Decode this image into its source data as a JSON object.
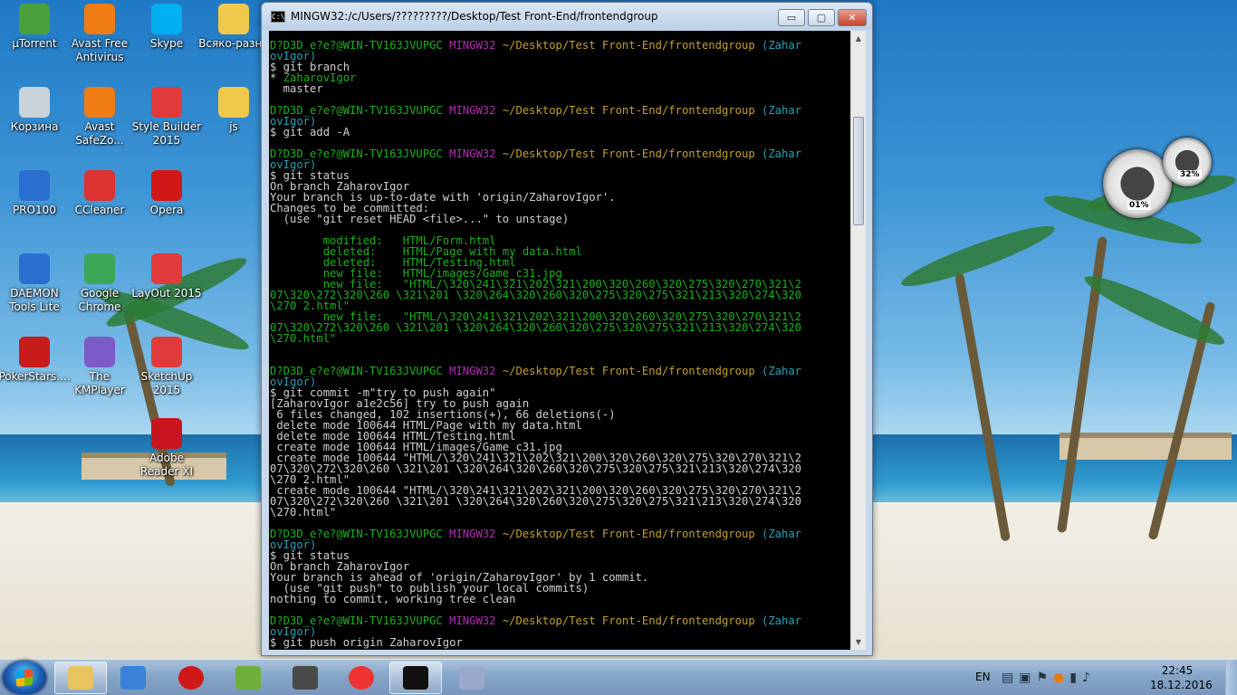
{
  "desktop_icons": [
    {
      "label": "µTorrent",
      "icon": "utorrent-icon",
      "color": "#4aa13b"
    },
    {
      "label": "Avast Free\nAntivirus",
      "icon": "avast-icon",
      "color": "#f07c14"
    },
    {
      "label": "Skype",
      "icon": "skype-icon",
      "color": "#00aff0"
    },
    {
      "label": "Всяко-разно",
      "icon": "folder-icon",
      "color": "#f0c84c"
    },
    {
      "label": "Корзина",
      "icon": "recycle-bin-icon",
      "color": "#c9d3dc"
    },
    {
      "label": "Avast\nSafeZo...",
      "icon": "avast-safezone-icon",
      "color": "#f07c14"
    },
    {
      "label": "Style Builder\n2015",
      "icon": "style-builder-icon",
      "color": "#e03a3a"
    },
    {
      "label": "js",
      "icon": "folder-icon",
      "color": "#f0c84c"
    },
    {
      "label": "PRO100",
      "icon": "pro100-icon",
      "color": "#2a6fd0"
    },
    {
      "label": "CCleaner",
      "icon": "ccleaner-icon",
      "color": "#d33"
    },
    {
      "label": "Opera",
      "icon": "opera-icon",
      "color": "#d01818"
    },
    {
      "label": "DAEMON\nTools Lite",
      "icon": "daemon-tools-icon",
      "color": "#2a6fd0"
    },
    {
      "label": "Google\nChrome",
      "icon": "chrome-icon",
      "color": "#3aa757"
    },
    {
      "label": "LayOut 2015",
      "icon": "layout-icon",
      "color": "#e03a3a"
    },
    {
      "label": "PokerStars....",
      "icon": "pokerstars-icon",
      "color": "#c81c1c"
    },
    {
      "label": "The\nKMPlayer",
      "icon": "kmplayer-icon",
      "color": "#7b5cc7"
    },
    {
      "label": "SketchUp\n2015",
      "icon": "sketchup-icon",
      "color": "#e03a3a"
    },
    {
      "label": "Adobe\nReader XI",
      "icon": "adobe-reader-icon",
      "color": "#c8141e"
    }
  ],
  "window": {
    "title": "MINGW32:/c/Users/?????????/Desktop/Test Front-End/frontendgroup",
    "minimize": "▭",
    "maximize": "▢",
    "close": "✕"
  },
  "terminal_lines": [
    [
      {
        "t": "D?D3D_e?e?@WIN-TV163JVUPGC ",
        "c": "g"
      },
      {
        "t": "MINGW32 ",
        "c": "p"
      },
      {
        "t": "~/Desktop/Test Front-End/frontendgroup ",
        "c": "y"
      },
      {
        "t": "(Zahar",
        "c": "c"
      }
    ],
    [
      {
        "t": "ovIgor)",
        "c": "c"
      }
    ],
    [
      {
        "t": "$ git branch",
        "c": "w"
      }
    ],
    [
      {
        "t": "* ",
        "c": "w"
      },
      {
        "t": "ZaharovIgor",
        "c": "g"
      }
    ],
    [
      {
        "t": "  master",
        "c": "w"
      }
    ],
    [
      {
        "t": "",
        "c": "w"
      }
    ],
    [
      {
        "t": "D?D3D_e?e?@WIN-TV163JVUPGC ",
        "c": "g"
      },
      {
        "t": "MINGW32 ",
        "c": "p"
      },
      {
        "t": "~/Desktop/Test Front-End/frontendgroup ",
        "c": "y"
      },
      {
        "t": "(Zahar",
        "c": "c"
      }
    ],
    [
      {
        "t": "ovIgor)",
        "c": "c"
      }
    ],
    [
      {
        "t": "$ git add -A",
        "c": "w"
      }
    ],
    [
      {
        "t": "",
        "c": "w"
      }
    ],
    [
      {
        "t": "D?D3D_e?e?@WIN-TV163JVUPGC ",
        "c": "g"
      },
      {
        "t": "MINGW32 ",
        "c": "p"
      },
      {
        "t": "~/Desktop/Test Front-End/frontendgroup ",
        "c": "y"
      },
      {
        "t": "(Zahar",
        "c": "c"
      }
    ],
    [
      {
        "t": "ovIgor)",
        "c": "c"
      }
    ],
    [
      {
        "t": "$ git status",
        "c": "w"
      }
    ],
    [
      {
        "t": "On branch ZaharovIgor",
        "c": "w"
      }
    ],
    [
      {
        "t": "Your branch is up-to-date with 'origin/ZaharovIgor'.",
        "c": "w"
      }
    ],
    [
      {
        "t": "Changes to be committed:",
        "c": "w"
      }
    ],
    [
      {
        "t": "  (use \"git reset HEAD <file>...\" to unstage)",
        "c": "w"
      }
    ],
    [
      {
        "t": "",
        "c": "w"
      }
    ],
    [
      {
        "t": "        modified:   HTML/Form.html",
        "c": "g"
      }
    ],
    [
      {
        "t": "        deleted:    HTML/Page with my data.html",
        "c": "g"
      }
    ],
    [
      {
        "t": "        deleted:    HTML/Testing.html",
        "c": "g"
      }
    ],
    [
      {
        "t": "        new file:   HTML/images/Game_c31.jpg",
        "c": "g"
      }
    ],
    [
      {
        "t": "        new file:   \"HTML/\\320\\241\\321\\202\\321\\200\\320\\260\\320\\275\\320\\270\\321\\2",
        "c": "g"
      }
    ],
    [
      {
        "t": "07\\320\\272\\320\\260 \\321\\201 \\320\\264\\320\\260\\320\\275\\320\\275\\321\\213\\320\\274\\320",
        "c": "g"
      }
    ],
    [
      {
        "t": "\\270 2.html\"",
        "c": "g"
      }
    ],
    [
      {
        "t": "        new file:   \"HTML/\\320\\241\\321\\202\\321\\200\\320\\260\\320\\275\\320\\270\\321\\2",
        "c": "g"
      }
    ],
    [
      {
        "t": "07\\320\\272\\320\\260 \\321\\201 \\320\\264\\320\\260\\320\\275\\320\\275\\321\\213\\320\\274\\320",
        "c": "g"
      }
    ],
    [
      {
        "t": "\\270.html\"",
        "c": "g"
      }
    ],
    [
      {
        "t": "",
        "c": "w"
      }
    ],
    [
      {
        "t": "",
        "c": "w"
      }
    ],
    [
      {
        "t": "D?D3D_e?e?@WIN-TV163JVUPGC ",
        "c": "g"
      },
      {
        "t": "MINGW32 ",
        "c": "p"
      },
      {
        "t": "~/Desktop/Test Front-End/frontendgroup ",
        "c": "y"
      },
      {
        "t": "(Zahar",
        "c": "c"
      }
    ],
    [
      {
        "t": "ovIgor)",
        "c": "c"
      }
    ],
    [
      {
        "t": "$ git commit -m\"try to push again\"",
        "c": "w"
      }
    ],
    [
      {
        "t": "[ZaharovIgor a1e2c56] try to push again",
        "c": "w"
      }
    ],
    [
      {
        "t": " 6 files changed, 102 insertions(+), 66 deletions(-)",
        "c": "w"
      }
    ],
    [
      {
        "t": " delete mode 100644 HTML/Page with my data.html",
        "c": "w"
      }
    ],
    [
      {
        "t": " delete mode 100644 HTML/Testing.html",
        "c": "w"
      }
    ],
    [
      {
        "t": " create mode 100644 HTML/images/Game_c31.jpg",
        "c": "w"
      }
    ],
    [
      {
        "t": " create mode 100644 \"HTML/\\320\\241\\321\\202\\321\\200\\320\\260\\320\\275\\320\\270\\321\\2",
        "c": "w"
      }
    ],
    [
      {
        "t": "07\\320\\272\\320\\260 \\321\\201 \\320\\264\\320\\260\\320\\275\\320\\275\\321\\213\\320\\274\\320",
        "c": "w"
      }
    ],
    [
      {
        "t": "\\270 2.html\"",
        "c": "w"
      }
    ],
    [
      {
        "t": " create mode 100644 \"HTML/\\320\\241\\321\\202\\321\\200\\320\\260\\320\\275\\320\\270\\321\\2",
        "c": "w"
      }
    ],
    [
      {
        "t": "07\\320\\272\\320\\260 \\321\\201 \\320\\264\\320\\260\\320\\275\\320\\275\\321\\213\\320\\274\\320",
        "c": "w"
      }
    ],
    [
      {
        "t": "\\270.html\"",
        "c": "w"
      }
    ],
    [
      {
        "t": "",
        "c": "w"
      }
    ],
    [
      {
        "t": "D?D3D_e?e?@WIN-TV163JVUPGC ",
        "c": "g"
      },
      {
        "t": "MINGW32 ",
        "c": "p"
      },
      {
        "t": "~/Desktop/Test Front-End/frontendgroup ",
        "c": "y"
      },
      {
        "t": "(Zahar",
        "c": "c"
      }
    ],
    [
      {
        "t": "ovIgor)",
        "c": "c"
      }
    ],
    [
      {
        "t": "$ git status",
        "c": "w"
      }
    ],
    [
      {
        "t": "On branch ZaharovIgor",
        "c": "w"
      }
    ],
    [
      {
        "t": "Your branch is ahead of 'origin/ZaharovIgor' by 1 commit.",
        "c": "w"
      }
    ],
    [
      {
        "t": "  (use \"git push\" to publish your local commits)",
        "c": "w"
      }
    ],
    [
      {
        "t": "nothing to commit, working tree clean",
        "c": "w"
      }
    ],
    [
      {
        "t": "",
        "c": "w"
      }
    ],
    [
      {
        "t": "D?D3D_e?e?@WIN-TV163JVUPGC ",
        "c": "g"
      },
      {
        "t": "MINGW32 ",
        "c": "p"
      },
      {
        "t": "~/Desktop/Test Front-End/frontendgroup ",
        "c": "y"
      },
      {
        "t": "(Zahar",
        "c": "c"
      }
    ],
    [
      {
        "t": "ovIgor)",
        "c": "c"
      }
    ],
    [
      {
        "t": "$ git push origin ZaharovIgor",
        "c": "w"
      }
    ]
  ],
  "gadget": {
    "cpu": "01%",
    "ram": "32%"
  },
  "taskbar": {
    "items": [
      {
        "name": "explorer-icon",
        "color": "#e8c460"
      },
      {
        "name": "media-player-icon",
        "color": "#3a82d8"
      },
      {
        "name": "opera-icon",
        "color": "#d01818"
      },
      {
        "name": "notepad-plus-icon",
        "color": "#6fb03a"
      },
      {
        "name": "sublime-text-icon",
        "color": "#4a4a4a"
      },
      {
        "name": "chrome-ball-icon",
        "color": "#e33"
      },
      {
        "name": "terminal-icon",
        "color": "#111"
      },
      {
        "name": "paint-icon",
        "color": "#9ac"
      }
    ],
    "language": "EN",
    "time": "22:45",
    "date": "18.12.2016"
  }
}
